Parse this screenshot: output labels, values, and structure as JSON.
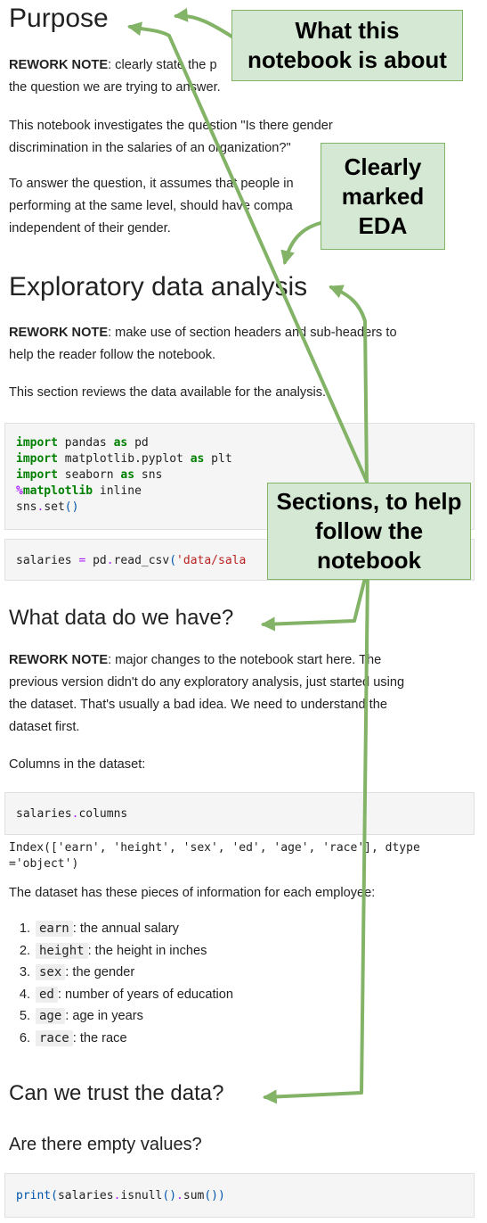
{
  "purpose": {
    "heading": "Purpose",
    "rework_label": "REWORK NOTE",
    "rework_line1": ": clearly state the p",
    "rework_line2": "the question we are trying to answer.",
    "investigates_line1": "This notebook investigates the question \"Is there gender",
    "investigates_line2": "discrimination in the salaries of an organization?\"",
    "answer_line1": "To answer the question, it assumes that people in",
    "answer_line2": "performing at the same level, should have compa",
    "answer_line3": "independent of their gender."
  },
  "eda": {
    "heading": "Exploratory data analysis",
    "rework_label": "REWORK NOTE",
    "rework_line1": ": make use of section headers and sub-headers to",
    "rework_line2": "help the reader follow the notebook.",
    "reviews": "This section reviews the data available for the analysis."
  },
  "code_imports": {
    "kw_import": "import",
    "kw_as": "as",
    "line1_mod": " pandas ",
    "line1_alias": " pd",
    "line2_mod": " matplotlib.pyplot ",
    "line2_alias": " plt",
    "line3_mod": " seaborn ",
    "line3_alias": " sns",
    "magic_pct": "%",
    "magic_word": "matplotlib",
    "magic_arg": " inline",
    "set_obj": "sns",
    "set_dot": ".",
    "set_fn": "set",
    "set_parens": "()"
  },
  "code_read": {
    "var": "salaries ",
    "eq": "=",
    "call": " pd",
    "dot": ".",
    "fn": "read_csv",
    "paren": "(",
    "str": "'data/sala"
  },
  "what_data": {
    "heading": "What data do we have?",
    "rework_label": "REWORK NOTE",
    "rework_line1": ": major changes to the notebook start here. The",
    "rework_line2": "previous version didn't do any exploratory analysis, just started using",
    "rework_line3": "the dataset. That's usually a bad idea. We need to understand the",
    "rework_line4": "dataset first.",
    "columns_intro": "Columns in the dataset:"
  },
  "code_columns": {
    "var": "salaries",
    "dot": ".",
    "attr": "columns"
  },
  "output_index": {
    "line1": "Index(['earn', 'height', 'sex', 'ed', 'age', 'race'], dtype",
    "line2": "='object')"
  },
  "pieces_intro": "The dataset has these pieces of information for each employee:",
  "fields": [
    {
      "num": "1.",
      "name": "earn",
      "desc": ": the annual salary"
    },
    {
      "num": "2.",
      "name": "height",
      "desc": ": the height in inches"
    },
    {
      "num": "3.",
      "name": "sex",
      "desc": ": the gender"
    },
    {
      "num": "4.",
      "name": "ed",
      "desc": ": number of years of education"
    },
    {
      "num": "5.",
      "name": "age",
      "desc": ": age in years"
    },
    {
      "num": "6.",
      "name": "race",
      "desc": ": the race"
    }
  ],
  "trust": {
    "heading": "Can we trust the data?",
    "subheading": "Are there empty values?"
  },
  "code_print": {
    "fn": "print",
    "paren": "(",
    "var": "salaries",
    "dot1": ".",
    "call1": "isnull",
    "parens1": "()",
    "dot2": ".",
    "call2": "sum",
    "parens2": "())"
  },
  "callouts": {
    "what_about": [
      "What this",
      "notebook is about"
    ],
    "eda": [
      "Clearly",
      "marked",
      "EDA"
    ],
    "sections": [
      "Sections, to help",
      "follow the",
      "notebook"
    ]
  },
  "colors": {
    "callout_fill": "#d5e8d4",
    "callout_border": "#82b366",
    "arrow": "#82b366",
    "code_bg": "#f5f5f5",
    "keyword": "#008000",
    "magic": "#aa22ff",
    "string": "#ba2121"
  }
}
